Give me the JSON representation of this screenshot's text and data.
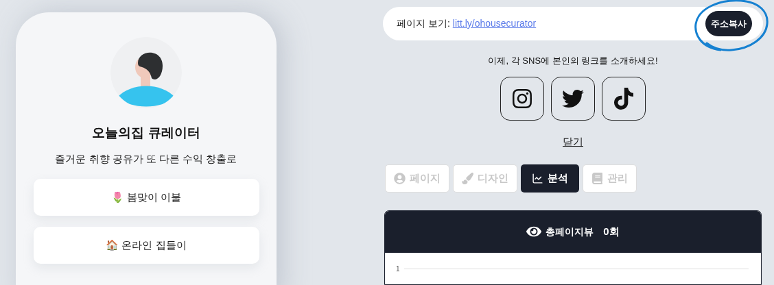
{
  "profile": {
    "name": "오늘의집 큐레이터",
    "bio": "즐거운 취향 공유가 또 다른 수익 창출로"
  },
  "links": [
    {
      "emoji": "🌷",
      "label": "봄맞이 이불"
    },
    {
      "emoji": "🏠",
      "label": "온라인 집들이"
    }
  ],
  "url_bar": {
    "label": "페이지 보기:",
    "url": "litt.ly/ohousecurator",
    "copy_button": "주소복사"
  },
  "share": {
    "message": "이제, 각 SNS에 본인의 링크를 소개하세요!",
    "networks": [
      {
        "kind": "instagram"
      },
      {
        "kind": "twitter"
      },
      {
        "kind": "tiktok"
      }
    ],
    "close": "닫기"
  },
  "tabs": [
    {
      "kind": "page",
      "label": "페이지",
      "selected": false
    },
    {
      "kind": "design",
      "label": "디자인",
      "selected": false
    },
    {
      "kind": "analytics",
      "label": "분석",
      "selected": true
    },
    {
      "kind": "manage",
      "label": "관리",
      "selected": false
    }
  ],
  "stats": {
    "label": "총페이지뷰",
    "value": "0회",
    "y_tick": "1"
  }
}
